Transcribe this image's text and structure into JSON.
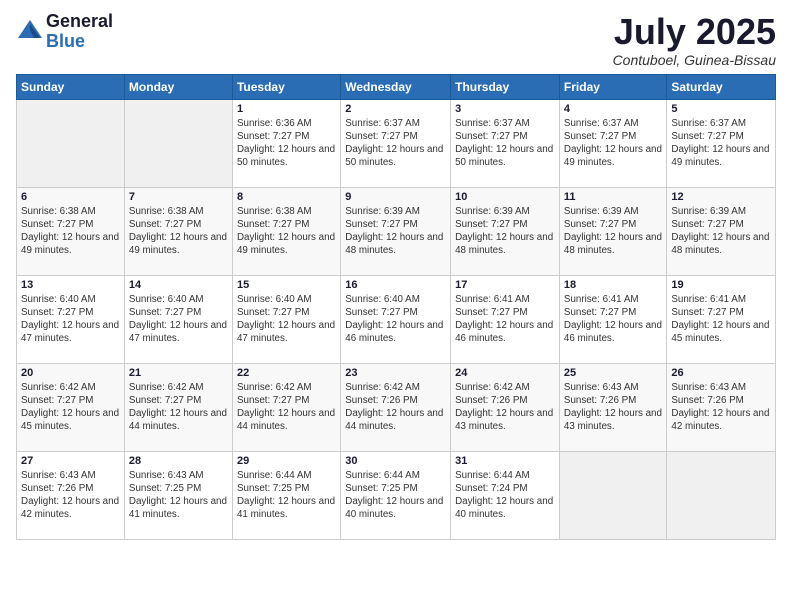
{
  "header": {
    "logo_general": "General",
    "logo_blue": "Blue",
    "month_title": "July 2025",
    "location": "Contuboel, Guinea-Bissau"
  },
  "days_of_week": [
    "Sunday",
    "Monday",
    "Tuesday",
    "Wednesday",
    "Thursday",
    "Friday",
    "Saturday"
  ],
  "weeks": [
    [
      {
        "day": "",
        "sunrise": "",
        "sunset": "",
        "daylight": ""
      },
      {
        "day": "",
        "sunrise": "",
        "sunset": "",
        "daylight": ""
      },
      {
        "day": "1",
        "sunrise": "Sunrise: 6:36 AM",
        "sunset": "Sunset: 7:27 PM",
        "daylight": "Daylight: 12 hours and 50 minutes."
      },
      {
        "day": "2",
        "sunrise": "Sunrise: 6:37 AM",
        "sunset": "Sunset: 7:27 PM",
        "daylight": "Daylight: 12 hours and 50 minutes."
      },
      {
        "day": "3",
        "sunrise": "Sunrise: 6:37 AM",
        "sunset": "Sunset: 7:27 PM",
        "daylight": "Daylight: 12 hours and 50 minutes."
      },
      {
        "day": "4",
        "sunrise": "Sunrise: 6:37 AM",
        "sunset": "Sunset: 7:27 PM",
        "daylight": "Daylight: 12 hours and 49 minutes."
      },
      {
        "day": "5",
        "sunrise": "Sunrise: 6:37 AM",
        "sunset": "Sunset: 7:27 PM",
        "daylight": "Daylight: 12 hours and 49 minutes."
      }
    ],
    [
      {
        "day": "6",
        "sunrise": "Sunrise: 6:38 AM",
        "sunset": "Sunset: 7:27 PM",
        "daylight": "Daylight: 12 hours and 49 minutes."
      },
      {
        "day": "7",
        "sunrise": "Sunrise: 6:38 AM",
        "sunset": "Sunset: 7:27 PM",
        "daylight": "Daylight: 12 hours and 49 minutes."
      },
      {
        "day": "8",
        "sunrise": "Sunrise: 6:38 AM",
        "sunset": "Sunset: 7:27 PM",
        "daylight": "Daylight: 12 hours and 49 minutes."
      },
      {
        "day": "9",
        "sunrise": "Sunrise: 6:39 AM",
        "sunset": "Sunset: 7:27 PM",
        "daylight": "Daylight: 12 hours and 48 minutes."
      },
      {
        "day": "10",
        "sunrise": "Sunrise: 6:39 AM",
        "sunset": "Sunset: 7:27 PM",
        "daylight": "Daylight: 12 hours and 48 minutes."
      },
      {
        "day": "11",
        "sunrise": "Sunrise: 6:39 AM",
        "sunset": "Sunset: 7:27 PM",
        "daylight": "Daylight: 12 hours and 48 minutes."
      },
      {
        "day": "12",
        "sunrise": "Sunrise: 6:39 AM",
        "sunset": "Sunset: 7:27 PM",
        "daylight": "Daylight: 12 hours and 48 minutes."
      }
    ],
    [
      {
        "day": "13",
        "sunrise": "Sunrise: 6:40 AM",
        "sunset": "Sunset: 7:27 PM",
        "daylight": "Daylight: 12 hours and 47 minutes."
      },
      {
        "day": "14",
        "sunrise": "Sunrise: 6:40 AM",
        "sunset": "Sunset: 7:27 PM",
        "daylight": "Daylight: 12 hours and 47 minutes."
      },
      {
        "day": "15",
        "sunrise": "Sunrise: 6:40 AM",
        "sunset": "Sunset: 7:27 PM",
        "daylight": "Daylight: 12 hours and 47 minutes."
      },
      {
        "day": "16",
        "sunrise": "Sunrise: 6:40 AM",
        "sunset": "Sunset: 7:27 PM",
        "daylight": "Daylight: 12 hours and 46 minutes."
      },
      {
        "day": "17",
        "sunrise": "Sunrise: 6:41 AM",
        "sunset": "Sunset: 7:27 PM",
        "daylight": "Daylight: 12 hours and 46 minutes."
      },
      {
        "day": "18",
        "sunrise": "Sunrise: 6:41 AM",
        "sunset": "Sunset: 7:27 PM",
        "daylight": "Daylight: 12 hours and 46 minutes."
      },
      {
        "day": "19",
        "sunrise": "Sunrise: 6:41 AM",
        "sunset": "Sunset: 7:27 PM",
        "daylight": "Daylight: 12 hours and 45 minutes."
      }
    ],
    [
      {
        "day": "20",
        "sunrise": "Sunrise: 6:42 AM",
        "sunset": "Sunset: 7:27 PM",
        "daylight": "Daylight: 12 hours and 45 minutes."
      },
      {
        "day": "21",
        "sunrise": "Sunrise: 6:42 AM",
        "sunset": "Sunset: 7:27 PM",
        "daylight": "Daylight: 12 hours and 44 minutes."
      },
      {
        "day": "22",
        "sunrise": "Sunrise: 6:42 AM",
        "sunset": "Sunset: 7:27 PM",
        "daylight": "Daylight: 12 hours and 44 minutes."
      },
      {
        "day": "23",
        "sunrise": "Sunrise: 6:42 AM",
        "sunset": "Sunset: 7:26 PM",
        "daylight": "Daylight: 12 hours and 44 minutes."
      },
      {
        "day": "24",
        "sunrise": "Sunrise: 6:42 AM",
        "sunset": "Sunset: 7:26 PM",
        "daylight": "Daylight: 12 hours and 43 minutes."
      },
      {
        "day": "25",
        "sunrise": "Sunrise: 6:43 AM",
        "sunset": "Sunset: 7:26 PM",
        "daylight": "Daylight: 12 hours and 43 minutes."
      },
      {
        "day": "26",
        "sunrise": "Sunrise: 6:43 AM",
        "sunset": "Sunset: 7:26 PM",
        "daylight": "Daylight: 12 hours and 42 minutes."
      }
    ],
    [
      {
        "day": "27",
        "sunrise": "Sunrise: 6:43 AM",
        "sunset": "Sunset: 7:26 PM",
        "daylight": "Daylight: 12 hours and 42 minutes."
      },
      {
        "day": "28",
        "sunrise": "Sunrise: 6:43 AM",
        "sunset": "Sunset: 7:25 PM",
        "daylight": "Daylight: 12 hours and 41 minutes."
      },
      {
        "day": "29",
        "sunrise": "Sunrise: 6:44 AM",
        "sunset": "Sunset: 7:25 PM",
        "daylight": "Daylight: 12 hours and 41 minutes."
      },
      {
        "day": "30",
        "sunrise": "Sunrise: 6:44 AM",
        "sunset": "Sunset: 7:25 PM",
        "daylight": "Daylight: 12 hours and 40 minutes."
      },
      {
        "day": "31",
        "sunrise": "Sunrise: 6:44 AM",
        "sunset": "Sunset: 7:24 PM",
        "daylight": "Daylight: 12 hours and 40 minutes."
      },
      {
        "day": "",
        "sunrise": "",
        "sunset": "",
        "daylight": ""
      },
      {
        "day": "",
        "sunrise": "",
        "sunset": "",
        "daylight": ""
      }
    ]
  ]
}
